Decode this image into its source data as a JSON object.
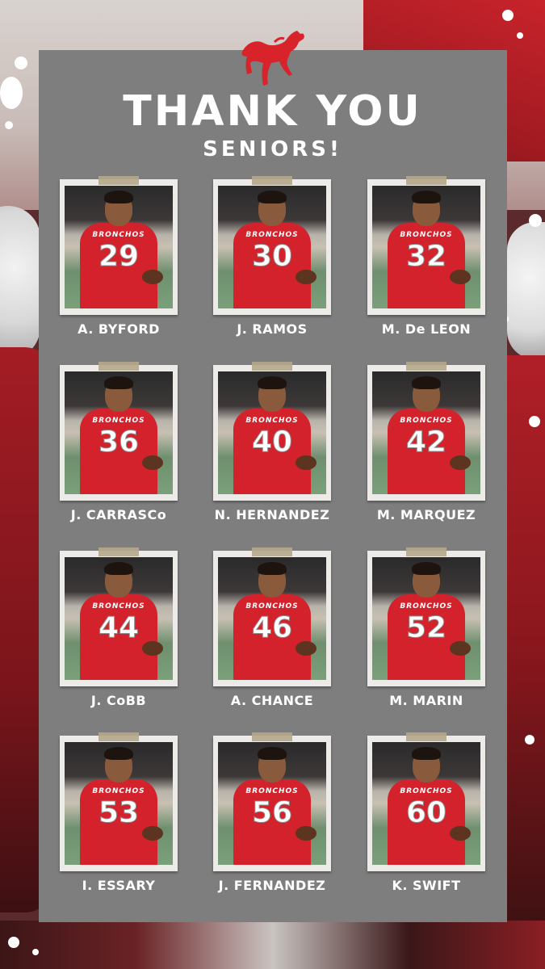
{
  "header": {
    "logo_icon": "bronco-horse-icon",
    "title_line1": "THANK YOU",
    "title_line2": "SENIORS!"
  },
  "colors": {
    "panel": "#7e7e7e",
    "jersey_red": "#d3222b",
    "text": "#ffffff"
  },
  "seniors": [
    {
      "name": "A. BYFORD",
      "number": "29",
      "team": "BRONCHOS"
    },
    {
      "name": "J. RAMOS",
      "number": "30",
      "team": "BRONCHOS"
    },
    {
      "name": "M. De LEON",
      "number": "32",
      "team": "BRONCHOS"
    },
    {
      "name": "J. CARRASCo",
      "number": "36",
      "team": "BRONCHOS"
    },
    {
      "name": "N. HERNANDEZ",
      "number": "40",
      "team": "BRONCHOS"
    },
    {
      "name": "M. MARQUEZ",
      "number": "42",
      "team": "BRONCHOS"
    },
    {
      "name": "J. CoBB",
      "number": "44",
      "team": "BRONCHOS"
    },
    {
      "name": "A. CHANCE",
      "number": "46",
      "team": "BRONCHOS"
    },
    {
      "name": "M. MARIN",
      "number": "52",
      "team": "BRONCHOS"
    },
    {
      "name": "I. ESSARY",
      "number": "53",
      "team": "BRONCHOS"
    },
    {
      "name": "J. FERNANDEZ",
      "number": "56",
      "team": "BRONCHOS"
    },
    {
      "name": "K. SWIFT",
      "number": "60",
      "team": "BRONCHOS"
    }
  ]
}
